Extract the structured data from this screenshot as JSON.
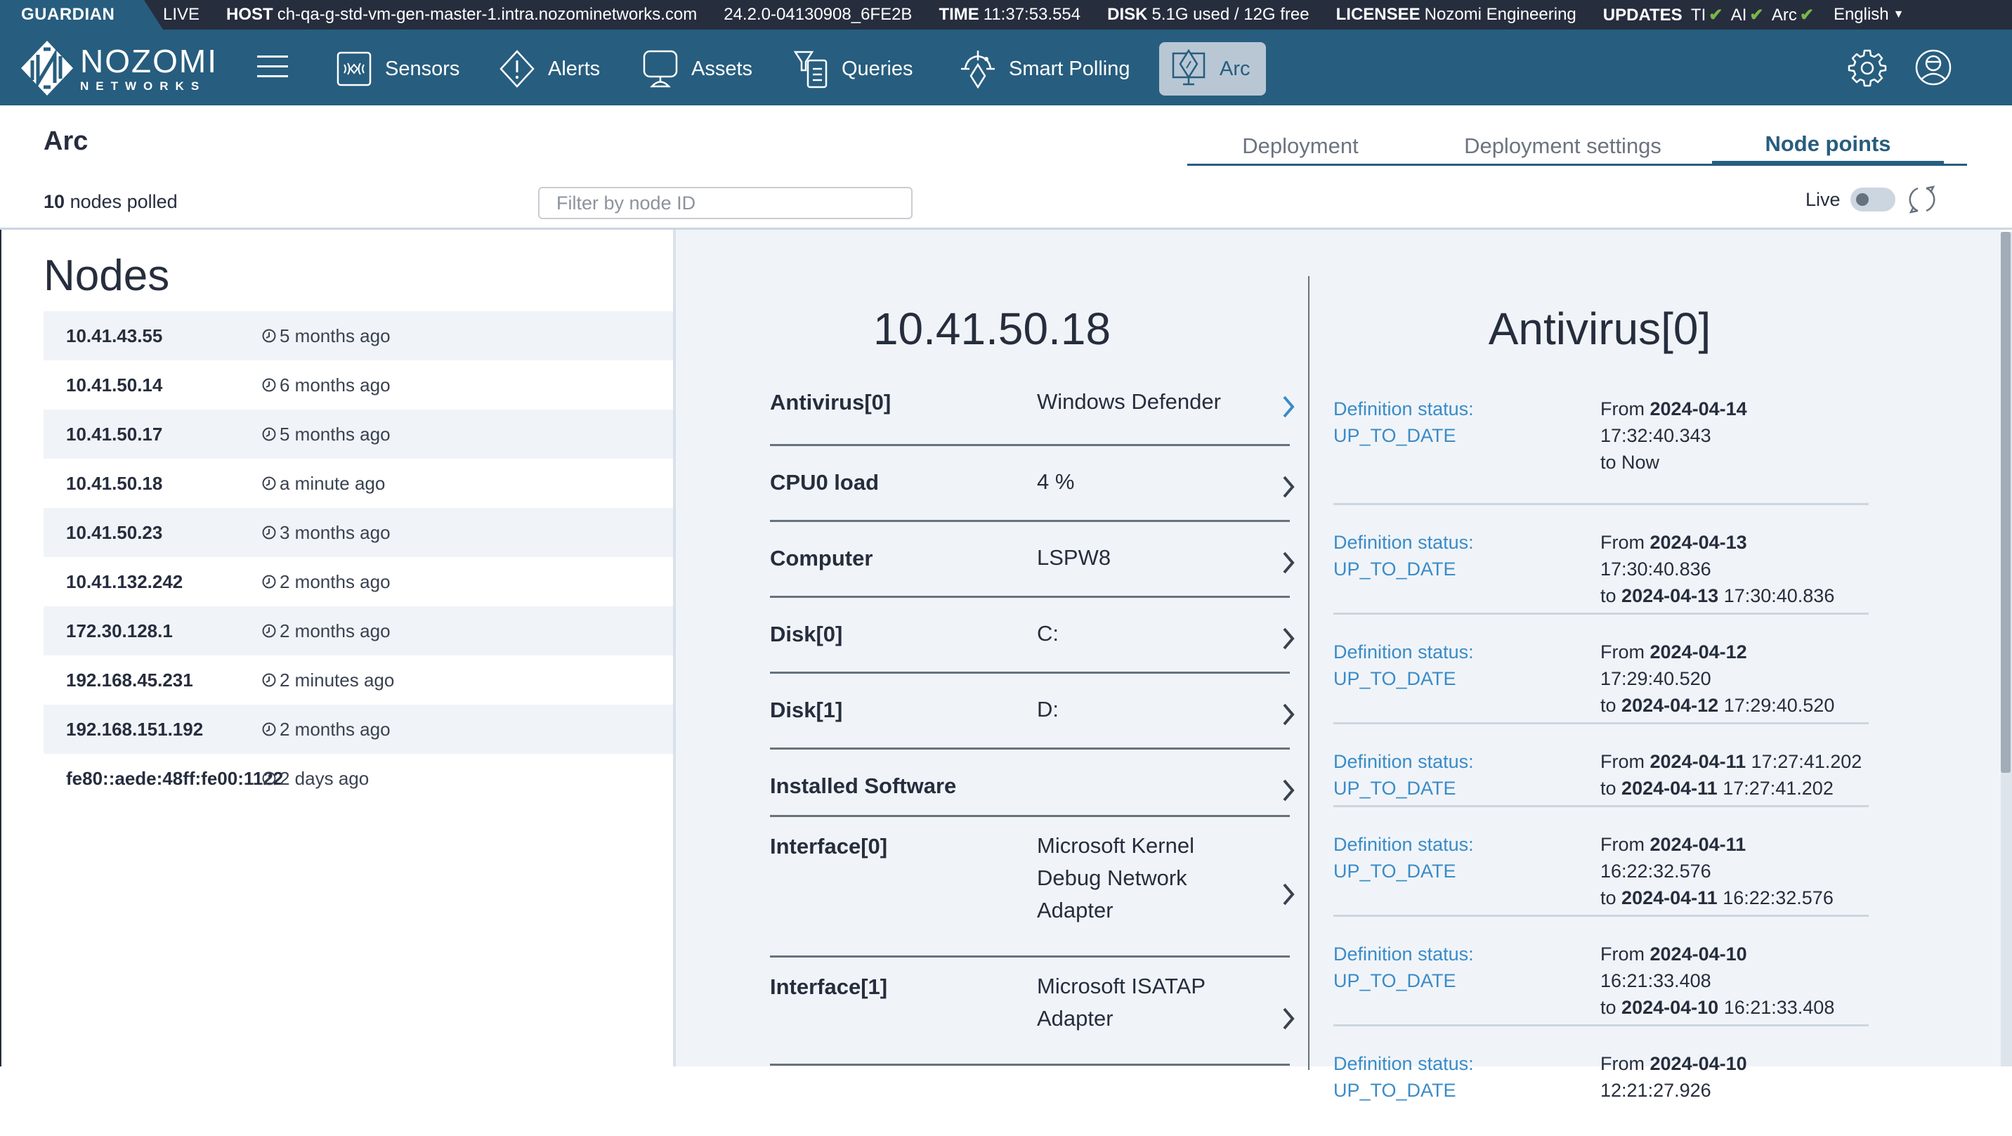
{
  "statusbar": {
    "product": "GUARDIAN",
    "mode": "LIVE",
    "host_label": "HOST",
    "host": "ch-qa-g-std-vm-gen-master-1.intra.nozominetworks.com",
    "version": "24.2.0-04130908_6FE2B",
    "time_label": "TIME",
    "time": "11:37:53.554",
    "disk_label": "DISK",
    "disk": "5.1G used / 12G free",
    "licensee_label": "LICENSEE",
    "licensee": "Nozomi Engineering",
    "updates_label": "UPDATES",
    "updates": [
      {
        "name": "TI",
        "status": "ok"
      },
      {
        "name": "AI",
        "status": "ok"
      },
      {
        "name": "Arc",
        "status": "ok"
      }
    ],
    "check_glyph": "✔",
    "language": "English"
  },
  "navbar": {
    "logo_line1": "NOZOMI",
    "logo_line2": "NETWORKS",
    "items": [
      {
        "label": "Sensors",
        "icon": "sensors-icon"
      },
      {
        "label": "Alerts",
        "icon": "alert-diamond-icon"
      },
      {
        "label": "Assets",
        "icon": "monitor-icon"
      },
      {
        "label": "Queries",
        "icon": "filter-list-icon"
      },
      {
        "label": "Smart Polling",
        "icon": "smart-polling-icon"
      },
      {
        "label": "Arc",
        "icon": "arc-monitor-icon",
        "active": true
      }
    ]
  },
  "header": {
    "title": "Arc",
    "nodes_count": "10",
    "nodes_polled_label": "nodes polled",
    "filter_placeholder": "Filter by node ID",
    "filter_value": "",
    "tabs": [
      {
        "label": "Deployment",
        "active": false
      },
      {
        "label": "Deployment settings",
        "active": false
      },
      {
        "label": "Node points",
        "active": true
      }
    ],
    "live_label": "Live",
    "live_enabled": false
  },
  "nodes": {
    "heading": "Nodes",
    "items": [
      {
        "ip": "10.41.43.55",
        "last_seen": "5 months ago"
      },
      {
        "ip": "10.41.50.14",
        "last_seen": "6 months ago"
      },
      {
        "ip": "10.41.50.17",
        "last_seen": "5 months ago"
      },
      {
        "ip": "10.41.50.18",
        "last_seen": "a minute ago",
        "selected": true
      },
      {
        "ip": "10.41.50.23",
        "last_seen": "3 months ago"
      },
      {
        "ip": "10.41.132.242",
        "last_seen": "2 months ago"
      },
      {
        "ip": "172.30.128.1",
        "last_seen": "2 months ago"
      },
      {
        "ip": "192.168.45.231",
        "last_seen": "2 minutes ago"
      },
      {
        "ip": "192.168.151.192",
        "last_seen": "2 months ago"
      },
      {
        "ip": "fe80::aede:48ff:fe00:1122",
        "last_seen": "2 days ago"
      }
    ]
  },
  "node_detail": {
    "title": "10.41.50.18",
    "properties": [
      {
        "key": "Antivirus[0]",
        "value": "Windows Defender",
        "active": true
      },
      {
        "key": "CPU0 load",
        "value": "4 %"
      },
      {
        "key": "Computer",
        "value": "LSPW8"
      },
      {
        "key": "Disk[0]",
        "value": "C:"
      },
      {
        "key": "Disk[1]",
        "value": "D:"
      },
      {
        "key": "Installed Software",
        "value": ""
      },
      {
        "key": "Interface[0]",
        "value": "Microsoft Kernel Debug Network Adapter"
      },
      {
        "key": "Interface[1]",
        "value": "Microsoft ISATAP Adapter"
      }
    ]
  },
  "property_history": {
    "title": "Antivirus[0]",
    "entries": [
      {
        "status_label": "Definition status:",
        "status": "UP_TO_DATE",
        "from_label": "From",
        "from_date": "2024-04-14",
        "from_time": "17:32:40.343",
        "to_label": "to",
        "to_date": "",
        "to_time": "Now"
      },
      {
        "status_label": "Definition status:",
        "status": "UP_TO_DATE",
        "from_label": "From",
        "from_date": "2024-04-13",
        "from_time": "17:30:40.836",
        "to_label": "to",
        "to_date": "2024-04-13",
        "to_time": "17:30:40.836"
      },
      {
        "status_label": "Definition status:",
        "status": "UP_TO_DATE",
        "from_label": "From",
        "from_date": "2024-04-12",
        "from_time": "17:29:40.520",
        "to_label": "to",
        "to_date": "2024-04-12",
        "to_time": "17:29:40.520"
      },
      {
        "status_label": "Definition status:",
        "status": "UP_TO_DATE",
        "from_label": "From",
        "from_date": "2024-04-11",
        "from_time": "17:27:41.202",
        "to_label": "to",
        "to_date": "2024-04-11",
        "to_time": "17:27:41.202"
      },
      {
        "status_label": "Definition status:",
        "status": "UP_TO_DATE",
        "from_label": "From",
        "from_date": "2024-04-11",
        "from_time": "16:22:32.576",
        "to_label": "to",
        "to_date": "2024-04-11",
        "to_time": "16:22:32.576"
      },
      {
        "status_label": "Definition status:",
        "status": "UP_TO_DATE",
        "from_label": "From",
        "from_date": "2024-04-10",
        "from_time": "16:21:33.408",
        "to_label": "to",
        "to_date": "2024-04-10",
        "to_time": "16:21:33.408"
      },
      {
        "status_label": "Definition status:",
        "status": "UP_TO_DATE",
        "from_label": "From",
        "from_date": "2024-04-10",
        "from_time": "12:21:27.926",
        "to_label": "",
        "to_date": "",
        "to_time": ""
      }
    ]
  },
  "colors": {
    "topbar": "#262d3d",
    "brand": "#275d7e",
    "active_nav": "#b9c7d5",
    "link_blue": "#3a8bc8",
    "check_green": "#7ab648",
    "panel_bg": "#f0f4f8"
  }
}
